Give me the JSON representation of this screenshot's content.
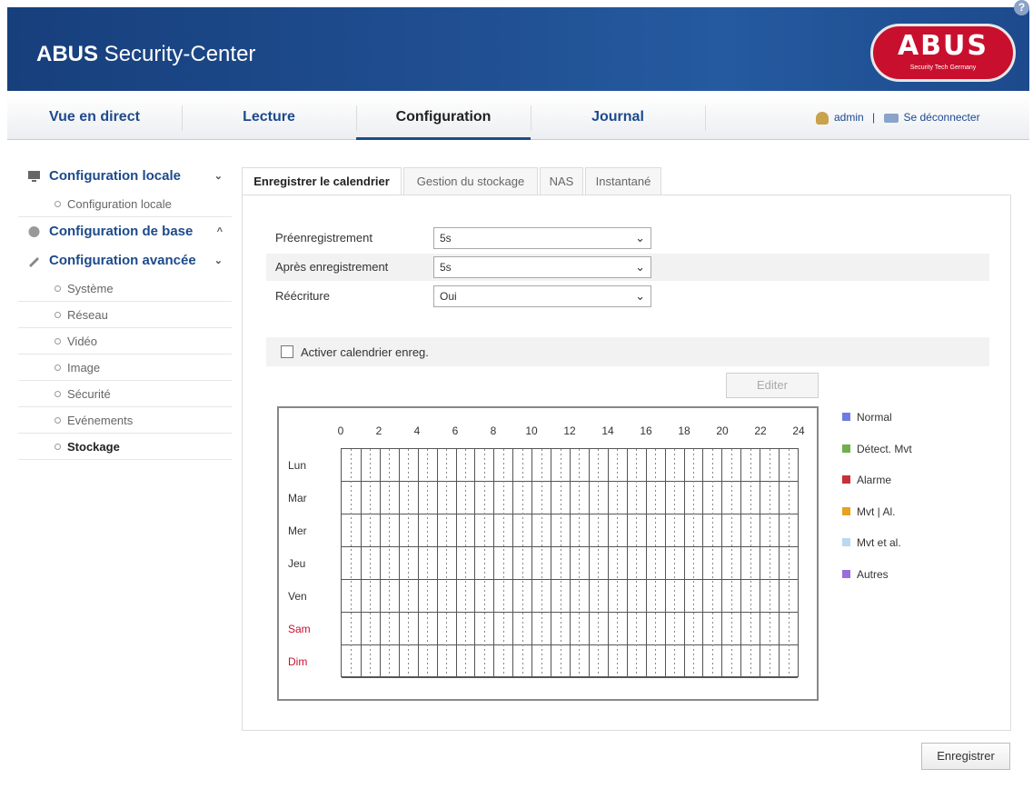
{
  "header": {
    "title_bold": "ABUS",
    "title_rest": " Security-Center",
    "logo_text": "ABUS",
    "logo_tagline": "Security Tech Germany",
    "help": "?"
  },
  "nav": {
    "tabs": [
      {
        "label": "Vue en direct"
      },
      {
        "label": "Lecture"
      },
      {
        "label": "Configuration"
      },
      {
        "label": "Journal"
      }
    ],
    "user": "admin",
    "separator": "|",
    "logout": "Se déconnecter"
  },
  "sidebar": {
    "groups": [
      {
        "label": "Configuration locale",
        "chevron": "⌄"
      },
      {
        "label": "Configuration de base",
        "chevron": "^"
      },
      {
        "label": "Configuration avancée",
        "chevron": "⌄"
      }
    ],
    "local_items": [
      "Configuration locale"
    ],
    "advanced_items": [
      "Système",
      "Réseau",
      "Vidéo",
      "Image",
      "Sécurité",
      "Evénements",
      "Stockage"
    ]
  },
  "tabs": [
    "Enregistrer le calendrier",
    "Gestion du stockage",
    "NAS",
    "Instantané"
  ],
  "form": {
    "pre_label": "Préenregistrement",
    "pre_value": "5s",
    "post_label": "Après enregistrement",
    "post_value": "5s",
    "overwrite_label": "Réécriture",
    "overwrite_value": "Oui",
    "enable_label": "Activer calendrier enreg.",
    "edit_label": "Editer",
    "save_label": "Enregistrer"
  },
  "schedule": {
    "hours": [
      "0",
      "2",
      "4",
      "6",
      "8",
      "10",
      "12",
      "14",
      "16",
      "18",
      "20",
      "22",
      "24"
    ],
    "days": [
      "Lun",
      "Mar",
      "Mer",
      "Jeu",
      "Ven",
      "Sam",
      "Dim"
    ]
  },
  "legend": [
    {
      "label": "Normal",
      "color": "#6f7de0"
    },
    {
      "label": "Détect. Mvt",
      "color": "#6fb04a"
    },
    {
      "label": "Alarme",
      "color": "#c8303a"
    },
    {
      "label": "Mvt | Al.",
      "color": "#e8a020"
    },
    {
      "label": "Mvt et al.",
      "color": "#bcd8ee"
    },
    {
      "label": "Autres",
      "color": "#9a6fdc"
    }
  ]
}
